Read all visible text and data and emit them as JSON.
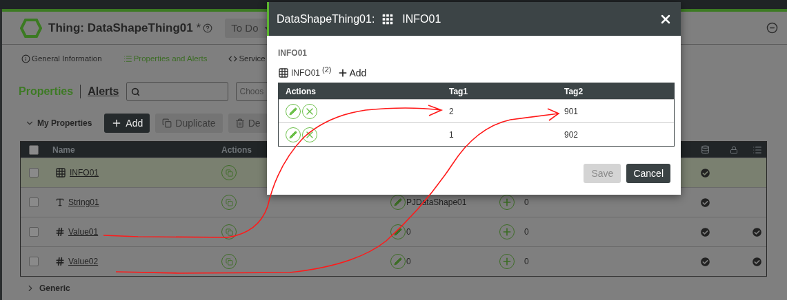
{
  "header": {
    "title": "Thing: DataShapeThing01",
    "modified_mark": "*",
    "status_dropdown": "To Do"
  },
  "nav_tabs": [
    {
      "label": "General Information",
      "kind": "info",
      "selected": false
    },
    {
      "label": "Properties and Alerts",
      "kind": "list",
      "selected": true
    },
    {
      "label": "Service",
      "kind": "code",
      "selected": false
    }
  ],
  "section_tabs": [
    {
      "label": "Properties",
      "selected": true
    },
    {
      "label": "Alerts",
      "selected": false
    }
  ],
  "filter_select": {
    "placeholder": "Choos"
  },
  "group": {
    "label": "My Properties",
    "expanded": true
  },
  "toolbar": [
    {
      "label": "Add",
      "kind": "add",
      "disabled": false
    },
    {
      "label": "Duplicate",
      "kind": "duplicate",
      "disabled": true
    },
    {
      "label": "De",
      "kind": "delete",
      "disabled": true
    }
  ],
  "table": {
    "all_checked": false,
    "columns": [
      "Name",
      "Actions"
    ],
    "rows": [
      {
        "name": "INFO01",
        "kind": "infotable",
        "selected": true,
        "checked": false,
        "persistent": true,
        "logged": false
      },
      {
        "name": "String01",
        "kind": "string",
        "selected": false,
        "checked": false,
        "value": "PJDataShape01",
        "count": "0",
        "persistent": true,
        "logged": false
      },
      {
        "name": "Value01",
        "kind": "number",
        "selected": false,
        "checked": false,
        "value": "0",
        "count": "0",
        "persistent": true,
        "logged": true
      },
      {
        "name": "Value02",
        "kind": "number",
        "selected": false,
        "checked": false,
        "value": "0",
        "count": "0",
        "persistent": true,
        "logged": true
      }
    ]
  },
  "collapsed_group": {
    "label": "Generic",
    "expanded": false
  },
  "dialog": {
    "title": "DataShapeThing01:",
    "subtitle": "INFO01",
    "section_label": "INFO01",
    "table_name": "INFO01",
    "count": "(2)",
    "add_label": "Add",
    "columns": [
      "Actions",
      "Tag1",
      "Tag2"
    ],
    "rows": [
      {
        "tag1": "2",
        "tag2": "901"
      },
      {
        "tag1": "1",
        "tag2": "902"
      }
    ],
    "buttons": [
      {
        "label": "Save",
        "disabled": true
      },
      {
        "label": "Cancel",
        "disabled": false
      }
    ]
  }
}
